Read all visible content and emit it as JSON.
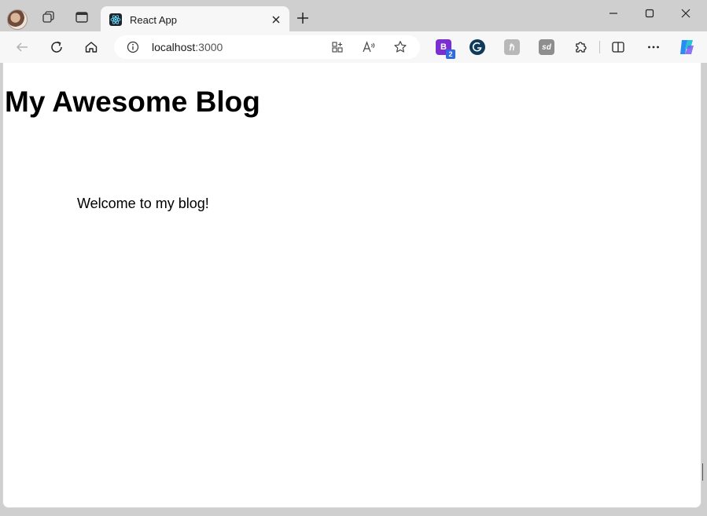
{
  "tab": {
    "title": "React App"
  },
  "address_bar": {
    "host": "localhost",
    "port": ":3000"
  },
  "extensions": {
    "badge_count": "2"
  },
  "page": {
    "heading": "My Awesome Blog",
    "welcome_text": "Welcome to my blog!"
  },
  "colors": {
    "ext_purple": "#7b2fd1",
    "ext_badge": "#2d6be4",
    "ext_dark": "#0e3b5c",
    "ext_gray": "#9a9a9a",
    "copilot": "#2a8cf0"
  }
}
